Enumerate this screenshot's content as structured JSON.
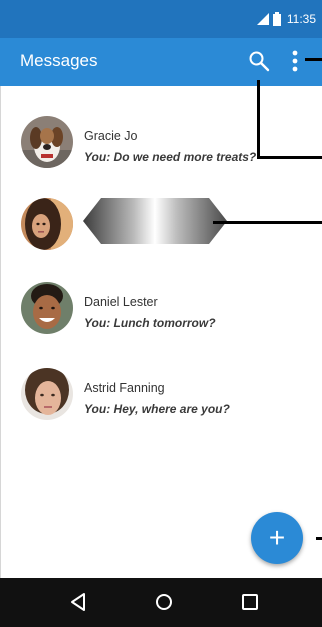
{
  "status_bar": {
    "time": "11:35",
    "icons": [
      "signal-icon",
      "battery-icon"
    ]
  },
  "app_bar": {
    "title": "Messages",
    "actions": [
      "search-icon",
      "overflow-menu-icon"
    ]
  },
  "conversations": [
    {
      "name": "Gracie Jo",
      "snippet": "You: Do we need more treats?",
      "avatar": "dog-photo"
    },
    {
      "name": "",
      "snippet": "",
      "avatar": "woman-photo",
      "redacted": true
    },
    {
      "name": "Daniel Lester",
      "snippet": "You: Lunch tomorrow?",
      "avatar": "man-photo"
    },
    {
      "name": "Astrid Fanning",
      "snippet": "You: Hey, where are you?",
      "avatar": "woman-photo"
    }
  ],
  "fab": {
    "label": "+",
    "icon": "add-icon"
  },
  "nav_bar": {
    "buttons": [
      "back-icon",
      "home-icon",
      "recents-icon"
    ]
  },
  "colors": {
    "status_bar": "#2174bd",
    "app_bar": "#2b8ad6",
    "accent": "#2b8ad6",
    "nav_bar": "#111111"
  }
}
